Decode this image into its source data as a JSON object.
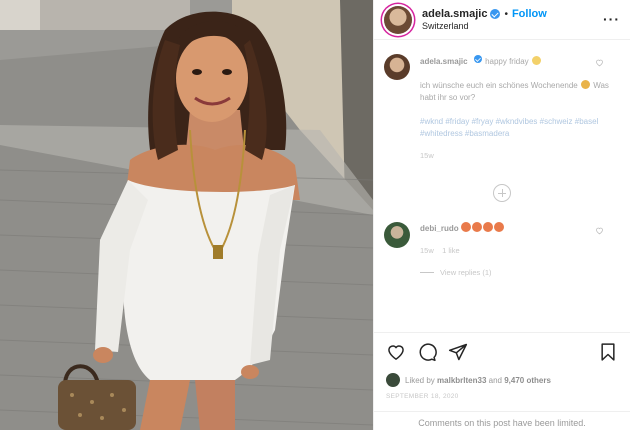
{
  "post": {
    "username": "adela.smajic",
    "follow_label": "Follow",
    "separator": "•",
    "location": "Switzerland",
    "more_label": "···"
  },
  "caption": {
    "username": "adela.smajic",
    "text_1": "happy friday",
    "text_2": "ich wünsche euch ein schönes Wochenende",
    "text_3": "Was habt ihr so vor?",
    "hashtags": "#wknd #friday #fryay #wkndvibes #schweiz #basel #whitedress #basmadera",
    "time": "15w"
  },
  "comment": {
    "username": "debi_rudo",
    "time": "15w",
    "likes": "1 like",
    "view_replies": "View replies (1)"
  },
  "footer": {
    "liked_by_prefix": "Liked by",
    "liked_by_user": "malkbrlten33",
    "liked_by_and": "and",
    "liked_by_others": "9,470 others",
    "date": "SEPTEMBER 18, 2020",
    "comments_limited": "Comments on this post have been limited."
  },
  "icons": {
    "like": "heart-icon",
    "comment": "comment-icon",
    "share": "paper-plane-icon",
    "save": "bookmark-icon",
    "add_comment": "plus-circle-icon",
    "verified": "verified-badge-icon"
  },
  "colors": {
    "follow": "#0095f6",
    "verified": "#3897f0",
    "story_ring": "#d6249f"
  }
}
